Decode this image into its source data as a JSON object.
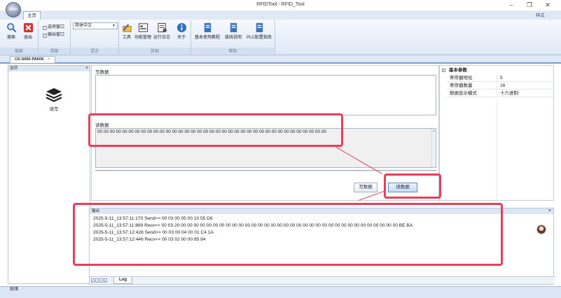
{
  "window": {
    "title": "RFIDTool - RFID_Tool",
    "logo_text": "RFID",
    "controls": {
      "minimize": "–",
      "restore": "❐",
      "close": "✕"
    }
  },
  "ribbon": {
    "tab_home": "主页",
    "style_menu": "样式 ·",
    "groups": {
      "search_label": "搜索",
      "view_label": "视图",
      "language_label": "语言",
      "other_label": "其他",
      "help_label": "帮助"
    },
    "buttons": {
      "search": "搜索",
      "exit": "退出",
      "tools": "工具",
      "function_mgmt": "功能管理",
      "run_log": "运行日志",
      "about": "关于",
      "basic_tutorial": "基本使用教程",
      "interface_doc": "接线说明",
      "plc_guide": "PLC配置指南"
    },
    "checks": {
      "option_window": "选项窗口",
      "output_window": "输出窗口"
    },
    "language_value": "简体中文"
  },
  "doc_tab": {
    "label": "CK-S650-PA60S",
    "close": "×"
  },
  "left_panel": {
    "header": "选项",
    "close": "×",
    "item_label": "读写"
  },
  "center": {
    "write_label": "写数据",
    "write_value": "",
    "read_label": "读数据",
    "read_value": "00 00 00 00 00 00 00 00 00 00 00 00 00 00 00 00 00 00 00 00 00 00 00 00 00 00 00 00 00 00 00 00 00 00 00 00 00",
    "write_button": "写数据",
    "read_button": "读数据"
  },
  "properties": {
    "section_title": "基本参数",
    "collapse_toggle": "−",
    "rows": [
      {
        "key": "寄存器地址",
        "value": "5"
      },
      {
        "key": "寄存器数量",
        "value": "16"
      },
      {
        "key": "数据显示模式",
        "value": "十六进制"
      }
    ]
  },
  "output": {
    "header": "输出",
    "close": "×",
    "lines": [
      "2025-5-11_13:57:11:170   Send>> 00 03 00 05 00 10 55 D6",
      "2025-5-11_13:57:11:889   Recv<< 00 03 20 00 00 00 00 00 00 00 00 00 00 00 00 00 00 00 00 00 00 00 00 00 00 00 00 00 00 00 00 00 00 00 00 00 00 BE BA",
      "2025-5-11_13:57:12:428   Send>> 00 03 00 04 00 01 C4 1A",
      "2025-5-11_13:57:12:446   Recv<< 00 03 02 00 00 85 84"
    ],
    "log_tab": "Log"
  },
  "statusbar": {
    "text": "就绪"
  },
  "colors": {
    "annotation": "#e8405a",
    "ribbon_bg": "#dfe9f5"
  },
  "icons": [
    "search-icon",
    "exit-icon",
    "tools-icon",
    "function-icon",
    "log-icon",
    "about-icon",
    "doc-icon",
    "layers-icon",
    "avatar"
  ]
}
